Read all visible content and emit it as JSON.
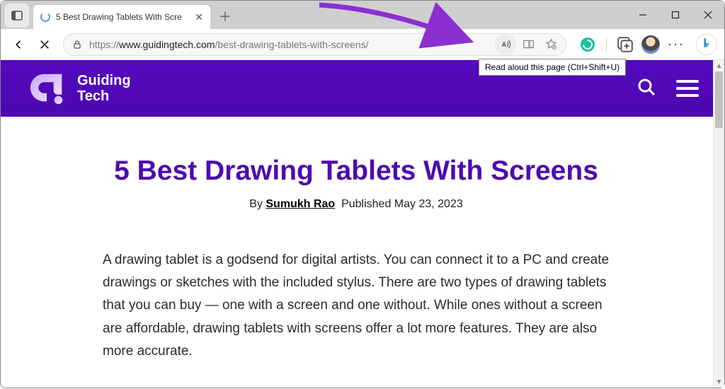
{
  "browser": {
    "tab_title": "5 Best Drawing Tablets With Scre",
    "url_prefix": "https://",
    "url_domain": "www.guidingtech.com",
    "url_path": "/best-drawing-tablets-with-screens/",
    "tooltip": "Read aloud this page (Ctrl+Shift+U)"
  },
  "site": {
    "name_line1": "Guiding",
    "name_line2": "Tech"
  },
  "article": {
    "title": "5 Best Drawing Tablets With Screens",
    "by_label": "By ",
    "author": "Sumukh Rao",
    "published_label": "Published ",
    "published_date": "May 23, 2023",
    "body": "A drawing tablet is a godsend for digital artists. You can connect it to a PC and create drawings or sketches with the included stylus. There are two types of drawing tablets that you can buy — one with a screen and one without. While ones without a screen are affordable, drawing tablets with screens offer a lot more features. They are also more accurate."
  }
}
